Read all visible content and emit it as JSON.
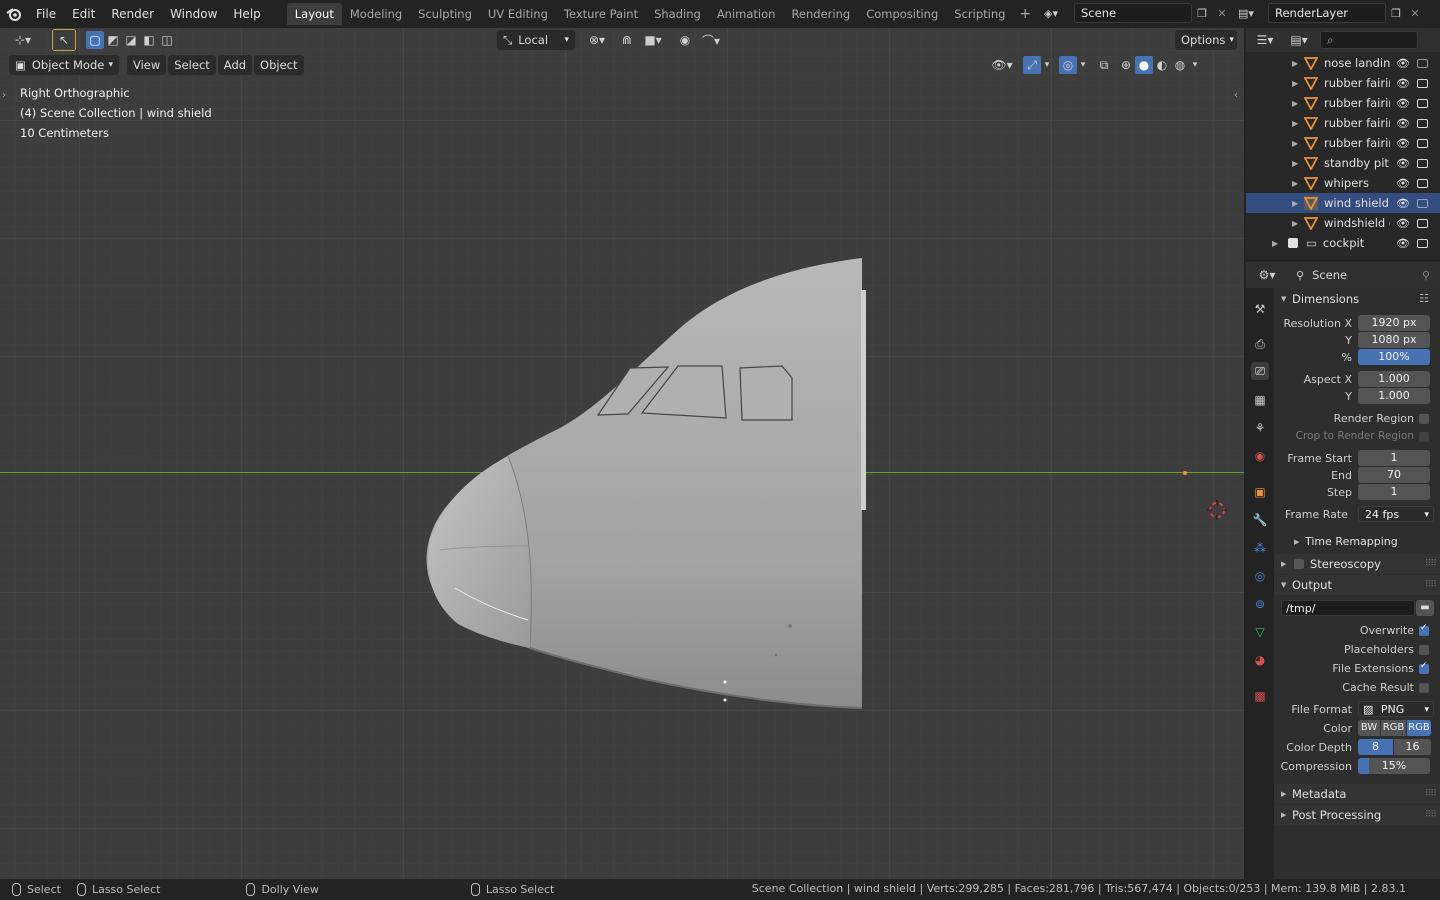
{
  "topbar": {
    "menus": [
      "File",
      "Edit",
      "Render",
      "Window",
      "Help"
    ],
    "workspaces": [
      "Layout",
      "Modeling",
      "Sculpting",
      "UV Editing",
      "Texture Paint",
      "Shading",
      "Animation",
      "Rendering",
      "Compositing",
      "Scripting"
    ],
    "active_workspace": "Layout",
    "scene_name": "Scene",
    "view_layer": "RenderLayer"
  },
  "viewport": {
    "transform_orientation": "Local",
    "options_label": "Options",
    "mode": "Object Mode",
    "menus": [
      "View",
      "Select",
      "Add",
      "Object"
    ],
    "view_name": "Right Orthographic",
    "collection_info": "(4) Scene Collection | wind shield",
    "scale_info": "10 Centimeters"
  },
  "outliner": {
    "rows": [
      {
        "label": "nose landing",
        "type": "mesh"
      },
      {
        "label": "rubber fairin",
        "type": "mesh"
      },
      {
        "label": "rubber fairin",
        "type": "mesh"
      },
      {
        "label": "rubber fairin",
        "type": "mesh"
      },
      {
        "label": "rubber fairin",
        "type": "mesh"
      },
      {
        "label": "standby pitit",
        "type": "mesh"
      },
      {
        "label": "whipers",
        "type": "mesh"
      },
      {
        "label": "wind shield",
        "type": "mesh",
        "selected": true
      },
      {
        "label": "windshield c",
        "type": "mesh"
      },
      {
        "label": "cockpit",
        "type": "collection"
      }
    ]
  },
  "properties": {
    "context": "Scene",
    "dimensions": {
      "title": "Dimensions",
      "resolution_x_label": "Resolution X",
      "resolution_x": "1920 px",
      "resolution_y_label": "Y",
      "resolution_y": "1080 px",
      "percent_label": "%",
      "percent": "100%",
      "aspect_x_label": "Aspect X",
      "aspect_x": "1.000",
      "aspect_y_label": "Y",
      "aspect_y": "1.000",
      "render_region": "Render Region",
      "crop_region": "Crop to Render Region",
      "frame_start_label": "Frame Start",
      "frame_start": "1",
      "frame_end_label": "End",
      "frame_end": "70",
      "frame_step_label": "Step",
      "frame_step": "1",
      "frame_rate_label": "Frame Rate",
      "frame_rate": "24 fps",
      "time_remapping": "Time Remapping"
    },
    "stereoscopy": "Stereoscopy",
    "output": {
      "title": "Output",
      "path": "/tmp/",
      "overwrite": "Overwrite",
      "placeholders": "Placeholders",
      "file_extensions": "File Extensions",
      "cache_result": "Cache Result",
      "file_format_label": "File Format",
      "file_format": "PNG",
      "color_label": "Color",
      "color_bw": "BW",
      "color_rgb": "RGB",
      "color_rgba": "RGB",
      "color_depth_label": "Color Depth",
      "depth_8": "8",
      "depth_16": "16",
      "compression_label": "Compression",
      "compression": "15%"
    },
    "metadata": "Metadata",
    "post_processing": "Post Processing"
  },
  "statusbar": {
    "select": "Select",
    "lasso": "Lasso Select",
    "dolly": "Dolly View",
    "lasso2": "Lasso Select",
    "info": "Scene Collection | wind shield | Verts:299,285 | Faces:281,796 | Tris:567,474 | Objects:0/253 | Mem: 139.8 MiB | 2.83.1"
  },
  "colors": {
    "accent": "#4772b3",
    "axis_green": "#6a9e2f",
    "mesh_orange": "#e8923a",
    "selection_row": "#334d80"
  }
}
